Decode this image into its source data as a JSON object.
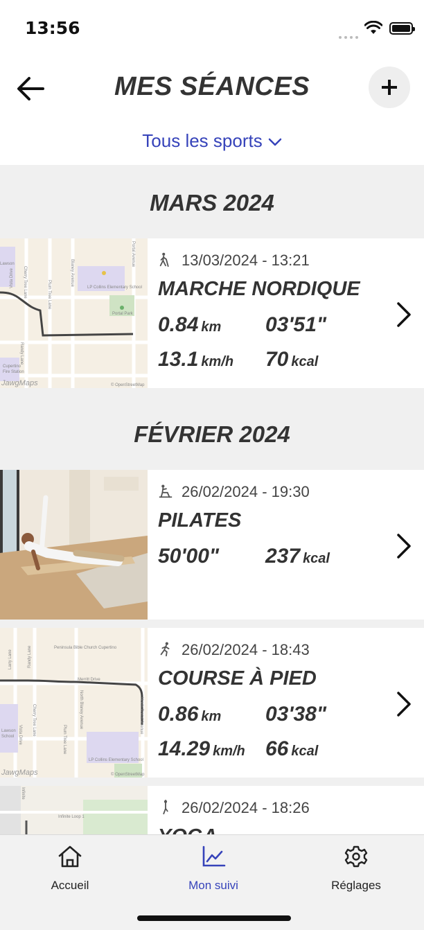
{
  "status_bar": {
    "time": "13:56"
  },
  "header": {
    "title": "MES SÉANCES"
  },
  "filter": {
    "label": "Tous les sports"
  },
  "months": [
    {
      "label": "MARS 2024",
      "sessions": [
        {
          "datetime": "13/03/2024 - 13:21",
          "sport": "MARCHE NORDIQUE",
          "distance_value": "0.84",
          "distance_unit": "km",
          "duration": "03'51\"",
          "speed_value": "13.1",
          "speed_unit": "km/h",
          "calories_value": "70",
          "calories_unit": "kcal",
          "map": {
            "streets": [
              "Cherry Tree Lane",
              "Plum Tree Lane",
              "Blaney Avenue",
              "Portal Avenue",
              "Vista Drive",
              "Randy Lane",
              "Lawson",
              "Cupertino",
              "Fire Station"
            ],
            "pois": [
              "LP Collins Elementary School",
              "Portal Park"
            ],
            "attribution": "© OpenStreetMap",
            "brand": "JawgMaps"
          }
        }
      ]
    },
    {
      "label": "FÉVRIER 2024",
      "sessions": [
        {
          "datetime": "26/02/2024 - 19:30",
          "sport": "PILATES",
          "duration": "50'00\"",
          "calories_value": "237",
          "calories_unit": "kcal"
        },
        {
          "datetime": "26/02/2024 - 18:43",
          "sport": "COURSE À PIED",
          "distance_value": "0.86",
          "distance_unit": "km",
          "duration": "03'38\"",
          "speed_value": "14.29",
          "speed_unit": "km/h",
          "calories_value": "66",
          "calories_unit": "kcal",
          "map": {
            "streets": [
              "Merritt Drive",
              "Larry Lane",
              "Randy Lane",
              "Cherry Tree Lane",
              "Plum Tree Lane",
              "North Blaney Avenue",
              "North Portal Avenue",
              "Vista Drive",
              "Lawson"
            ],
            "pois": [
              "Peninsula Bible Church Cupertino",
              "LP Collins Elementary School",
              "School"
            ],
            "attribution": "© OpenStreetMap",
            "brand": "JawgMaps"
          }
        },
        {
          "datetime": "26/02/2024 - 18:26",
          "sport": "YOGA",
          "map": {
            "streets": [
              "Infinite Loop 1",
              "Infinite"
            ]
          }
        }
      ]
    }
  ],
  "tabbar": {
    "tabs": [
      {
        "label": "Accueil"
      },
      {
        "label": "Mon suivi",
        "active": true
      },
      {
        "label": "Réglages"
      }
    ]
  },
  "colors": {
    "accent": "#3643ba",
    "text": "#333333",
    "background_section": "#f0f0f0"
  },
  "icons": [
    "back-arrow-icon",
    "plus-icon",
    "chevron-down-icon",
    "nordic-walking-icon",
    "pilates-icon",
    "running-icon",
    "yoga-icon",
    "chevron-right-icon",
    "home-icon",
    "chart-icon",
    "gear-icon"
  ]
}
